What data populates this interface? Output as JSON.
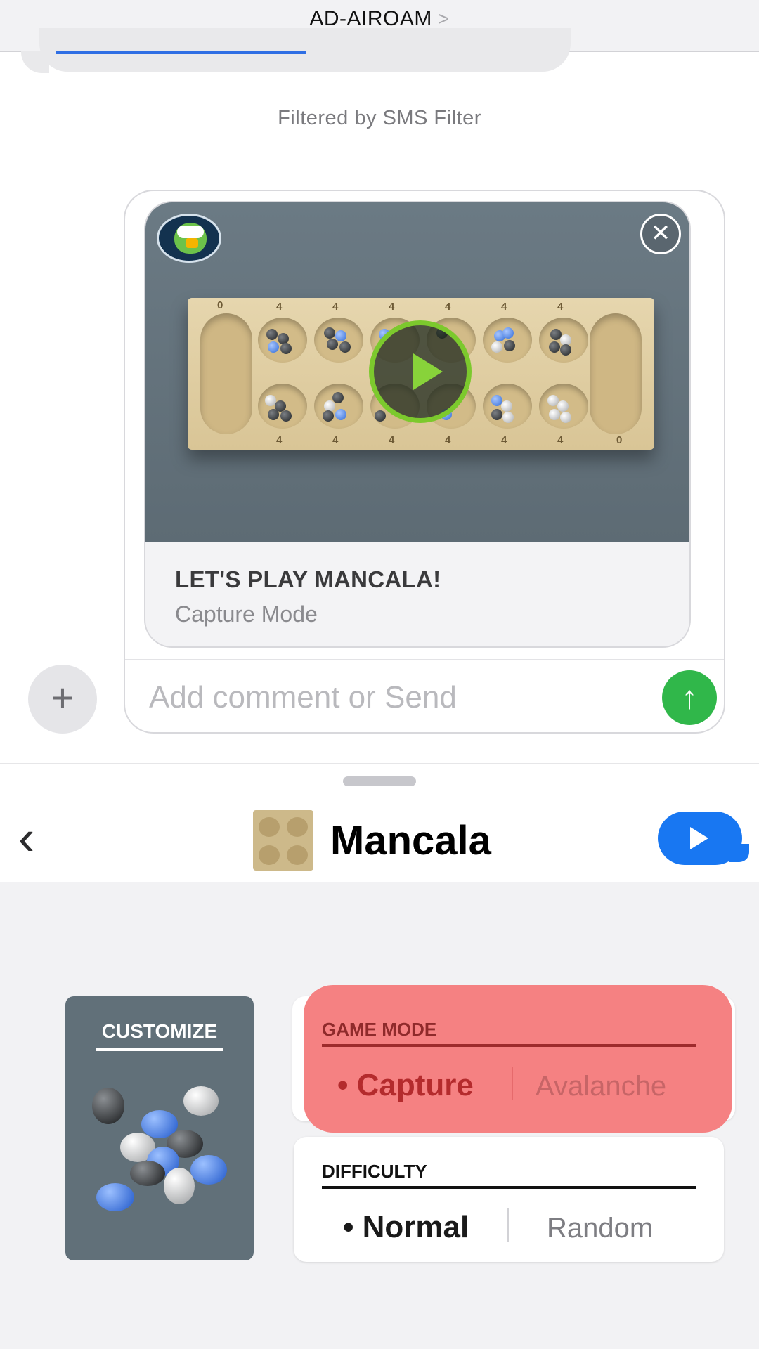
{
  "topnav": {
    "contact": "AD-AIROAM",
    "chevron": ">"
  },
  "filtered_label": "Filtered by SMS Filter",
  "card": {
    "title": "LET'S PLAY MANCALA!",
    "subtitle": "Capture Mode",
    "close_glyph": "✕",
    "board_numbers_top": [
      "0",
      "4",
      "4",
      "4",
      "4",
      "4",
      "4"
    ],
    "board_numbers_bottom": [
      "4",
      "4",
      "4",
      "4",
      "4",
      "4",
      "0"
    ]
  },
  "compose": {
    "placeholder": "Add comment or Send",
    "plus_glyph": "+",
    "send_glyph": "↑"
  },
  "drawer": {
    "back_glyph": "‹",
    "app_name": "Mancala",
    "customize_label": "CUSTOMIZE",
    "game_mode": {
      "header": "GAME MODE",
      "selected": "• Capture",
      "other": "Avalanche"
    },
    "difficulty": {
      "header": "DIFFICULTY",
      "selected": "• Normal",
      "other": "Random"
    }
  },
  "colors": {
    "accent_blue": "#1877f2",
    "send_green": "#30b74a",
    "play_green": "#7cc92d",
    "game_mode_highlight": "#f58182"
  },
  "icons": [
    "chevron-right-icon",
    "app-badge-icon",
    "close-icon",
    "play-icon",
    "plus-icon",
    "send-arrow-icon",
    "back-chevron-icon",
    "imessage-send-icon"
  ]
}
